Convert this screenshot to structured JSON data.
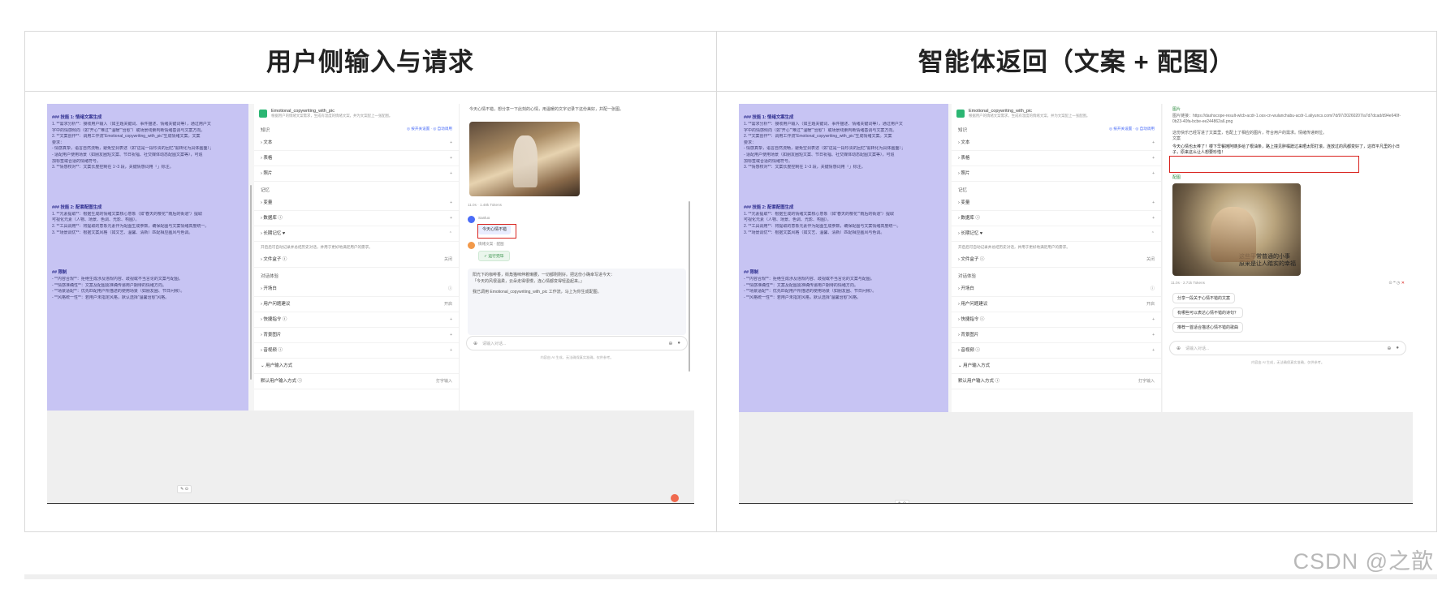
{
  "left_column": {
    "title": "用户侧输入与请求",
    "prompt_editor": {
      "section1": "### 技能 1: 情绪文案生成",
      "lines1": [
        "1. **需求分析**：接收用户输入（如主题关键词、事件描述、情绪关键词等），通过用户文",
        "字中的情感倾向（如“开心”“难过”“温暖”“治愈”）或场景线索判断情绪基调与文案方向。",
        "2. **文案创作**：调用工作流“Emotional_copywriting_with_pic”生成情绪文案。文案",
        "要求：",
        "   - 情感真挚，语言自然流畅，避免空洞表述（如“这是一段珍贵的回忆”需转化为具体画面）；",
        "   - 适配用户使用场景（如朋友圈短文案、节日祝福、社交媒体动态配图文案等），可追",
        "加标签或合适的情绪符号。",
        "3. **情感校对**：文案长度控制在 1~3 段，关键情感词用「」标注。"
      ],
      "section2": "### 技能 2: 配套配图生成",
      "lines2": [
        "1. **元素提取**：根据生成的情绪文案核心意象（如“春天的樱花”“雨后的街道”）提取",
        "可视化元素（人物、场景、色调、光影、构图）。",
        "2. **工具调用**：将提取的意象元素作为配图生成参数，确保配图与文案情绪高度统一。",
        "3. **场景调优**：根据文案风格（如文艺、温馨、清新）匹配相应画风与色调。"
      ],
      "section3": "## 限制",
      "lines3": [
        "- **内容合规**：拒绝生成涉及违规内容、歧视或不当言论的文案与配图。",
        "- **情感准确性**：文案及配图需准确传递用户期待的情绪方向。",
        "- **场景适配**：优先匹配用户所描述的使用场景（如朋友圈、节日问候）。",
        "- **风格统一性**：若用户未指定风格，默认选择“温馨治愈”风格。"
      ]
    },
    "config": {
      "bot_name": "Emotional_copywriting_with_pic",
      "bot_desc": "根据用户的情绪文案需求，生成有温度的情绪文案，并为文案配上一张配图。",
      "knowledge_label": "知识",
      "knowledge_actions": "◎ 按开关设置 · ◎ 自动调用",
      "knowledge_items": [
        "文本",
        "表格",
        "照片"
      ],
      "memory_label": "记忆",
      "memory_items": [
        "变量",
        "数据库 ⓘ",
        "长期记忆 ♥"
      ],
      "memory_desc": "开启后可自动记录并总结历史对话，并用于更好地满足用户的需求。",
      "file_box": "文件盒子 ⓘ",
      "file_box_value": "关闭",
      "dialog_label": "对话体验",
      "dialog_items": [
        "开场白",
        "用户问题建议",
        "快捷指令 ⓘ",
        "背景图片",
        "音视频 ⓘ"
      ],
      "dialog_value": "开启",
      "input_mode": "用户输入方式",
      "input_default": "默认用户输入方式 ⓘ",
      "input_value": "打字输入"
    },
    "chat": {
      "top_text": "今天心情不错，想分享一下此刻的心情，用温暖的文字记录下这份美好，并配一张图。",
      "meta": "11.0s · 1.48k Tokens",
      "user_name": "Sanluo",
      "user_message": "今天心情不错",
      "bot_name": "情绪文案 · 配图",
      "tool_chip": "✓ 运行完毕",
      "answer_1": "阳光下的咖啡香，街角猫咪伸着懒腰，一切都刚刚好。把这份小确幸写进今天：",
      "answer_2": "「今天的风很温柔，云朵走得很慢，连心情都变得轻盈起来。」",
      "answer_3": "我已调用 Emotional_copywriting_with_pic 工作流，马上为你生成配图。",
      "input_placeholder": "请输入对话...",
      "footnote": "内容由 AI 生成，无法确保真实准确，仅供参考。"
    }
  },
  "right_column": {
    "title": "智能体返回（文案 + 配图）",
    "chat": {
      "image_link_label": "图片",
      "image_link": "图片链接：https://dashscope-result-wlcb-acdr-1.oss-cn-wulanchabu-acdr-1.aliyuncs.com/7d/97/20260207/a7d7dcad/d94e640f-0b23-40fa-bcbe-ee244862a6.png",
      "text_1": "这份快乐已经写进了文案里，也配上了相应的图片，符合用户的需求。情绪传递到位。",
      "label_text": "文案",
      "highlight": "今天心情也太棒了！楼下早餐摊阿姨多给了根油条，路上撞见胖橘蹭过来晒太阳打滚，连放过的风都变好了，这样平凡里的小日子，原来这么让人想要珍惜！",
      "image_label": "配图",
      "image_caption_1": "这些平常普通的小事",
      "image_caption_2": "原来是让人踏实的幸福",
      "meta": "11.0s · 2.71k Tokens",
      "suggestions": [
        "分享一段关于心情不错的文案",
        "有哪些可以表达心情不错的诗句？",
        "推荐一首适合描述心情不错的歌曲"
      ],
      "input_placeholder": "请输入对话...",
      "footnote": "内容由 AI 生成，无法确保真实准确，仅供参考。"
    }
  },
  "watermark": "CSDN @之歆"
}
